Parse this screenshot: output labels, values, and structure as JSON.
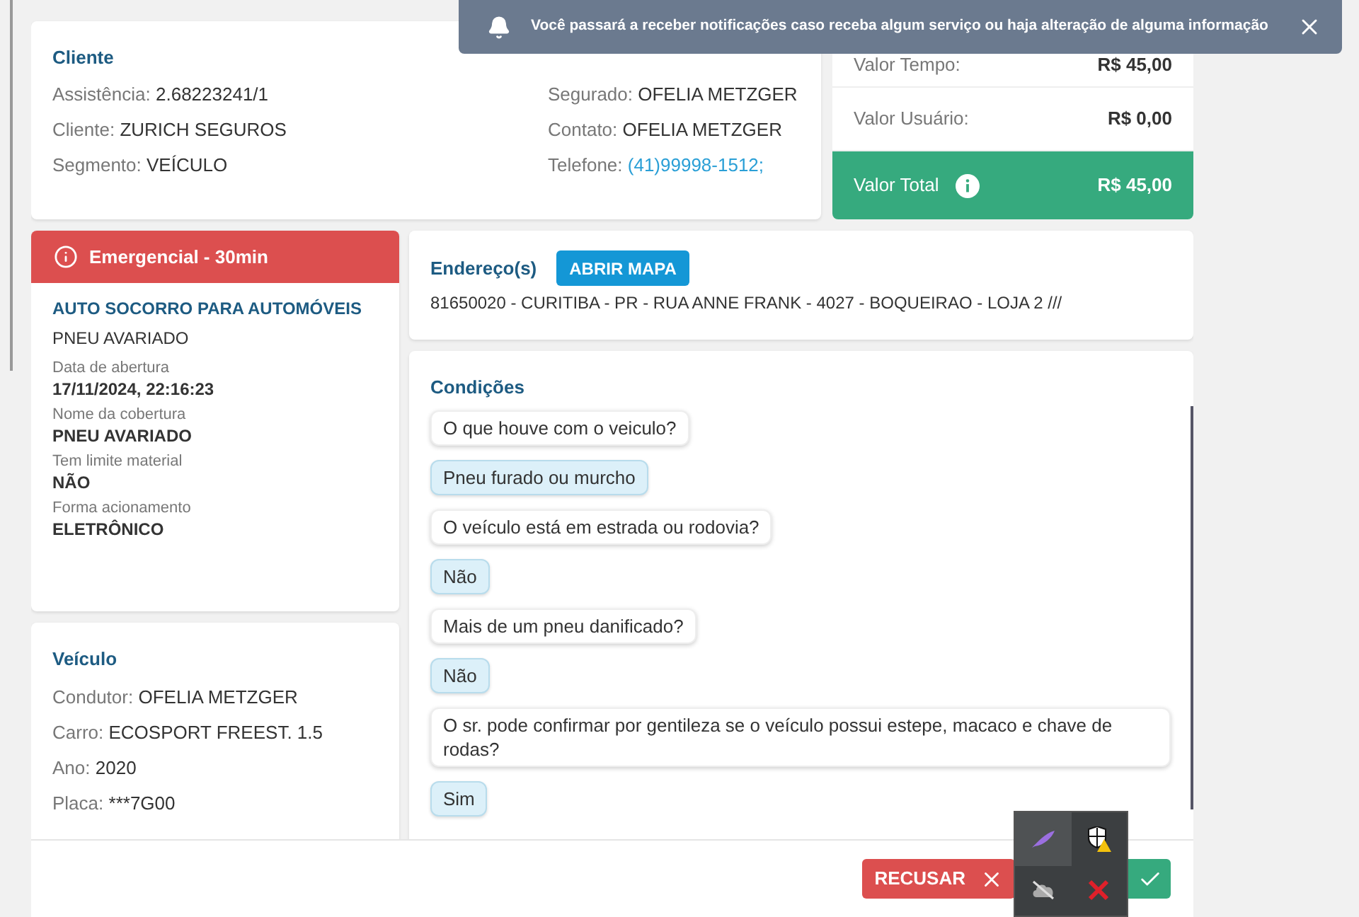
{
  "notification": {
    "text": "Você passará a receber notificações caso receba algum serviço ou haja alteração de alguma informação"
  },
  "client": {
    "title": "Cliente",
    "left": [
      {
        "label": "Assistência:",
        "value": "2.68223241/1",
        "link": false
      },
      {
        "label": "Cliente:",
        "value": "ZURICH SEGUROS",
        "link": false
      },
      {
        "label": "Segmento:",
        "value": "VEÍCULO",
        "link": false
      }
    ],
    "right": [
      {
        "label": "Segurado:",
        "value": "OFELIA METZGER",
        "link": false
      },
      {
        "label": "Contato:",
        "value": "OFELIA METZGER",
        "link": false
      },
      {
        "label": "Telefone:",
        "value": "(41)99998-1512;",
        "link": true
      }
    ]
  },
  "values": {
    "rows": [
      {
        "label": "Valor Tempo:",
        "value": "R$ 45,00"
      },
      {
        "label": "Valor Usuário:",
        "value": "R$ 0,00"
      }
    ],
    "total": {
      "label": "Valor Total",
      "value": "R$ 45,00"
    }
  },
  "service": {
    "priority": "Emergencial - 30min",
    "title": "AUTO SOCORRO PARA AUTOMÓVEIS",
    "subtitle": "PNEU AVARIADO",
    "fields": [
      {
        "label": "Data de abertura",
        "value": "17/11/2024, 22:16:23"
      },
      {
        "label": "Nome da cobertura",
        "value": "PNEU AVARIADO"
      },
      {
        "label": "Tem limite material",
        "value": "NÃO"
      },
      {
        "label": "Forma acionamento",
        "value": "ELETRÔNICO"
      }
    ]
  },
  "vehicle": {
    "title": "Veículo",
    "fields": [
      {
        "label": "Condutor:",
        "value": "OFELIA METZGER"
      },
      {
        "label": "Carro:",
        "value": "ECOSPORT FREEST. 1.5"
      },
      {
        "label": "Ano:",
        "value": "2020"
      },
      {
        "label": "Placa:",
        "value": "***7G00"
      }
    ]
  },
  "address": {
    "title": "Endereço(s)",
    "button": "ABRIR MAPA",
    "text": "81650020 - CURITIBA - PR - RUA ANNE FRANK - 4027 - BOQUEIRAO - LOJA 2 ///"
  },
  "conditions": {
    "title": "Condições",
    "messages": [
      {
        "kind": "question",
        "text": "O que houve com o veiculo?"
      },
      {
        "kind": "answer",
        "text": "Pneu furado ou murcho"
      },
      {
        "kind": "question",
        "text": "O veículo está em estrada ou rodovia?"
      },
      {
        "kind": "answer",
        "text": "Não"
      },
      {
        "kind": "question",
        "text": "Mais de um pneu danificado?"
      },
      {
        "kind": "answer",
        "text": "Não"
      },
      {
        "kind": "question",
        "text": "O sr. pode confirmar por gentileza se o veículo possui estepe, macaco e chave de rodas?"
      },
      {
        "kind": "answer",
        "text": "Sim"
      }
    ]
  },
  "actions": {
    "reject": "RECUSAR"
  }
}
